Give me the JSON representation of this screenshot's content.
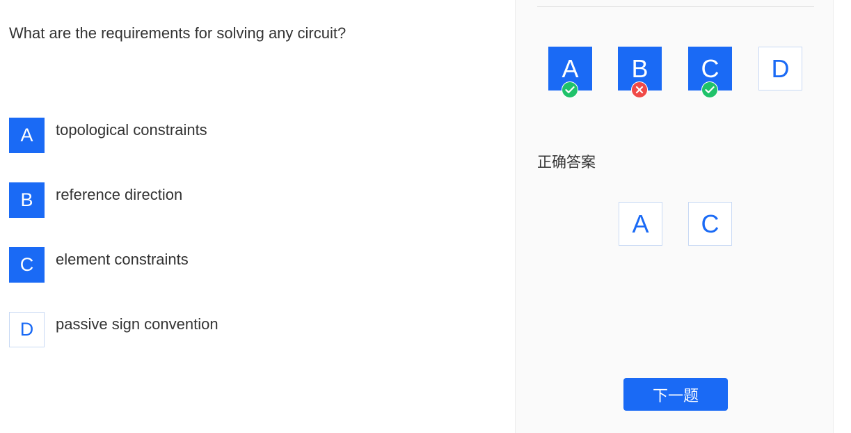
{
  "question": {
    "text": "What are the requirements for solving any circuit?",
    "options": [
      {
        "letter": "A",
        "text": "topological constraints",
        "selected": true
      },
      {
        "letter": "B",
        "text": "reference direction",
        "selected": true
      },
      {
        "letter": "C",
        "text": "element constraints",
        "selected": true
      },
      {
        "letter": "D",
        "text": "passive sign convention",
        "selected": false
      }
    ]
  },
  "answer_panel": {
    "chosen": [
      {
        "letter": "A",
        "selected": true,
        "status": "correct",
        "status_icon": "check-circle-icon"
      },
      {
        "letter": "B",
        "selected": true,
        "status": "wrong",
        "status_icon": "x-circle-icon"
      },
      {
        "letter": "C",
        "selected": true,
        "status": "correct",
        "status_icon": "check-circle-icon"
      },
      {
        "letter": "D",
        "selected": false,
        "status": "",
        "status_icon": ""
      }
    ],
    "correct_label": "正确答案",
    "correct_answers": [
      "A",
      "C"
    ],
    "next_button": "下一题"
  },
  "colors": {
    "accent": "#1a6af5",
    "correct": "#1fc26a",
    "wrong": "#f04a48"
  }
}
